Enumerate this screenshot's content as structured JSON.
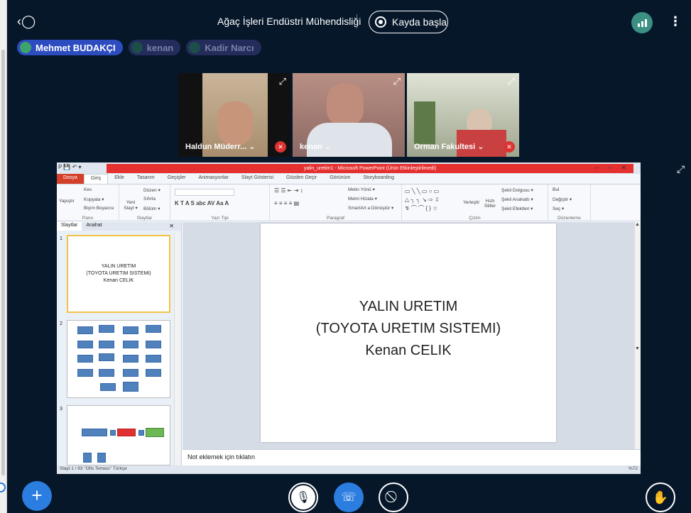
{
  "app": {
    "title": "Ağaç İşleri Endüstri Mühendisliği",
    "record_label": "Kayda başla"
  },
  "participants": [
    {
      "name": "Mehmet BUDAKÇI",
      "active": true
    },
    {
      "name": "kenan",
      "active": false
    },
    {
      "name": "Kadir Narcı",
      "active": false
    }
  ],
  "videos": [
    {
      "name": "Haldun Müderr... ⌄",
      "muted": true
    },
    {
      "name": "kenan ⌄",
      "muted": false
    },
    {
      "name": "Orman Fakultesi ⌄",
      "muted": true
    }
  ],
  "ppt": {
    "window_title": "yalin_uretim1 - Microsoft PowerPoint (Ürün Etkinleştirilmedi)",
    "tabs": [
      "Dosya",
      "Giriş",
      "Ekle",
      "Tasarım",
      "Geçişler",
      "Animasyonlar",
      "Slayt Gösterisi",
      "Gözden Geçir",
      "Görünüm",
      "Storyboarding"
    ],
    "ribbon": {
      "pano": {
        "label": "Pano",
        "yapistir": "Yapıştır",
        "kes": "Kes",
        "kopyala": "Kopyala ▾",
        "bicim": "Biçim Boyacısı"
      },
      "slaytlar": {
        "label": "Slaytlar",
        "yeni": "Yeni Slayt ▾",
        "duzen": "Düzen ▾",
        "sifirla": "Sıfırla",
        "bolum": "Bölüm ▾"
      },
      "yazi": {
        "label": "Yazı Tipi"
      },
      "paragraf": {
        "label": "Paragraf",
        "metin_yonu": "Metin Yönü ▾",
        "metni_hizala": "Metni Hizala ▾",
        "smartart": "SmartArt a Dönüştür ▾"
      },
      "cizim": {
        "label": "Çizim",
        "yerlestir": "Yerleştir",
        "hizli": "Hızlı Stiller",
        "dolgu": "Şekil Dolgusu ▾",
        "anahat": "Şekil Anahattı ▾",
        "efekt": "Şekil Efektleri ▾"
      },
      "duzenleme": {
        "label": "Düzenleme",
        "bul": "Bul",
        "degistir": "Değiştir ▾",
        "sec": "Seç ▾"
      }
    },
    "panel_tabs": [
      "Slaytlar",
      "Anahat"
    ],
    "slide1_lines": [
      "YALIN URETIM",
      "(TOYOTA URETIM SISTEMI)",
      "Kenan CELIK"
    ],
    "main_slide_lines": [
      "YALIN URETIM",
      "(TOYOTA URETIM SISTEMI)",
      "Kenan CELIK"
    ],
    "notes_placeholder": "Not eklemek için tıklatın",
    "status_left": "Slayt 1 / 93   \"Ofis Teması\"   Türkçe",
    "zoom": "%72"
  }
}
